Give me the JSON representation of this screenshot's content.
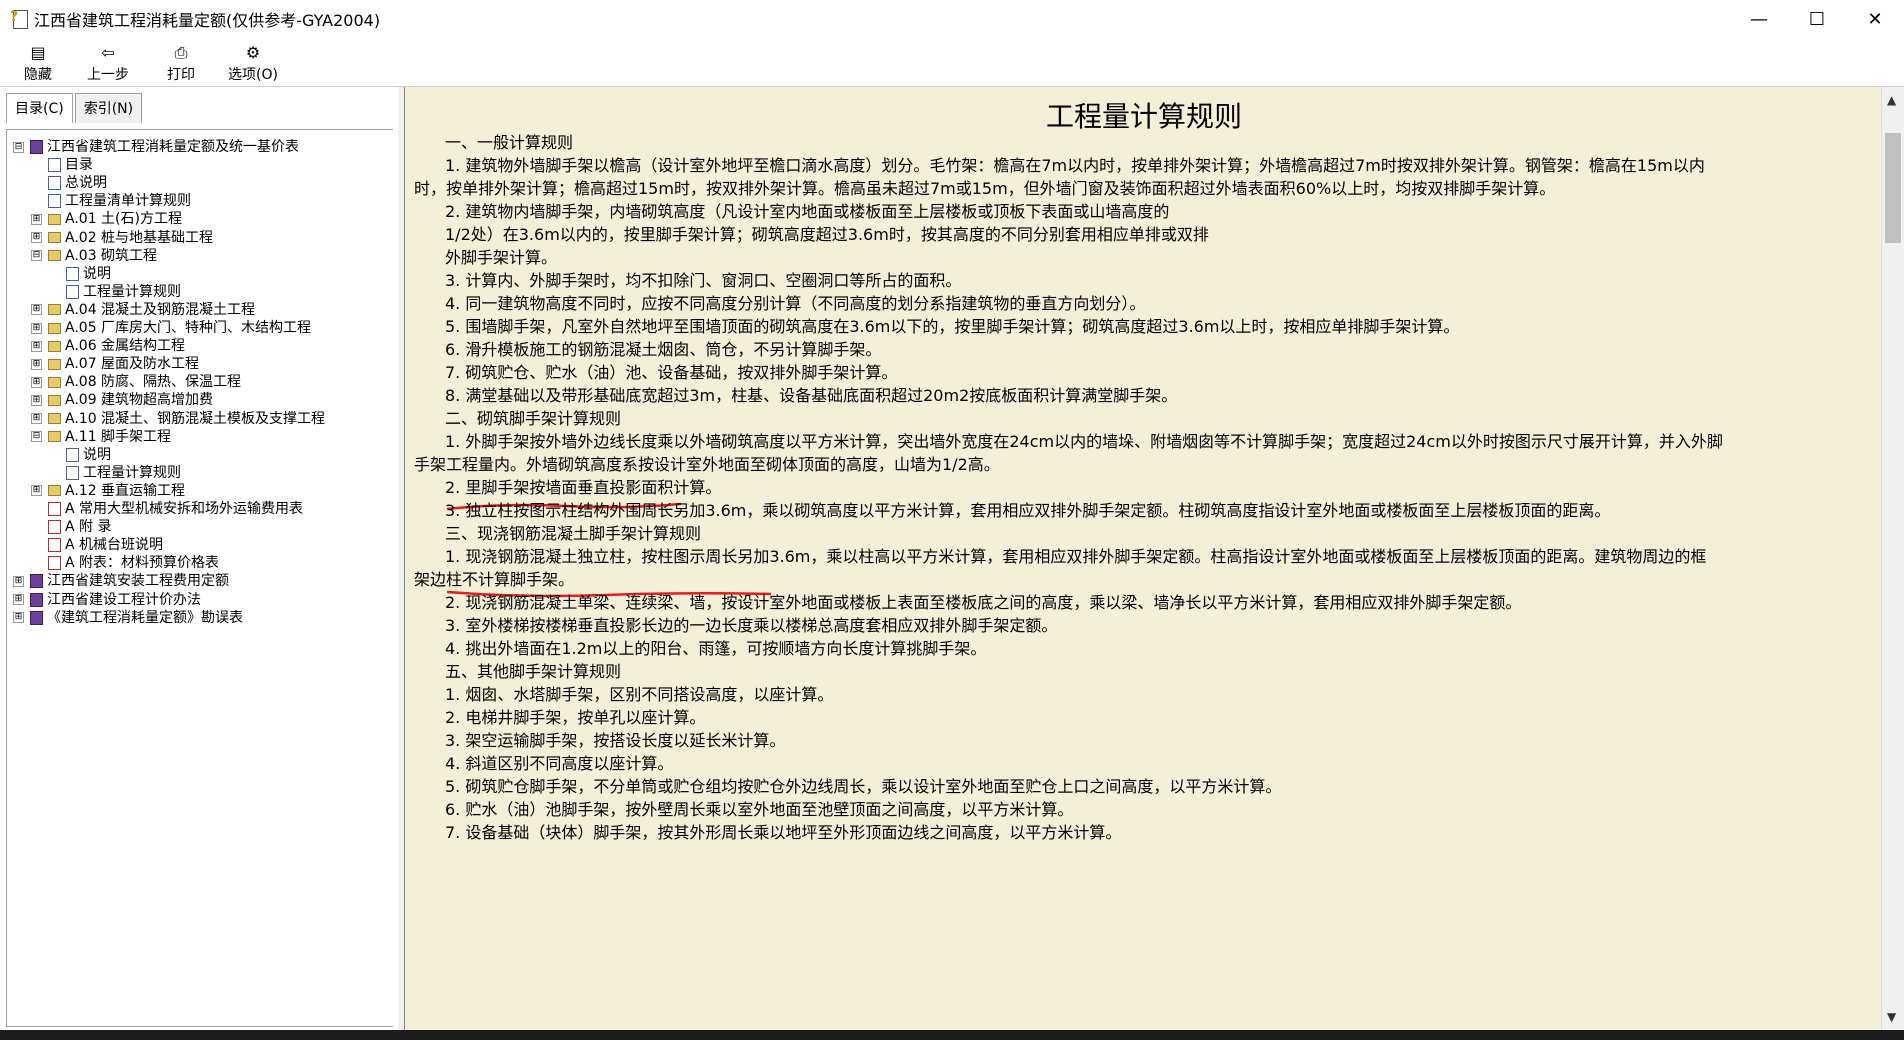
{
  "window": {
    "title": "江西省建筑工程消耗量定额(仅供参考-GYA2004)",
    "minimize": "—",
    "maximize": "☐",
    "close": "✕"
  },
  "toolbar": {
    "hide": "隐藏",
    "back": "上一步",
    "print": "打印",
    "options": "选项(O)",
    "hide_icon": "▤",
    "back_icon": "⇦",
    "print_icon": "⎙",
    "options_icon": "⚙"
  },
  "tabs": {
    "contents": "目录(C)",
    "index": "索引(N)"
  },
  "tree": [
    {
      "label": "江西省建筑工程消耗量定额及统一基价表",
      "expander": "⊟",
      "icon": "book"
    },
    {
      "label": "目录",
      "expander": "",
      "icon": "page"
    },
    {
      "label": "总说明",
      "expander": "",
      "icon": "page"
    },
    {
      "label": "工程量清单计算规则",
      "expander": "",
      "icon": "page"
    },
    {
      "label": "A.01  土(石)方工程",
      "expander": "⊞",
      "icon": "folder"
    },
    {
      "label": "A.02  桩与地基基础工程",
      "expander": "⊞",
      "icon": "folder"
    },
    {
      "label": "A.03  砌筑工程",
      "expander": "⊟",
      "icon": "folder"
    },
    {
      "label": "说明",
      "expander": "",
      "icon": "page"
    },
    {
      "label": "工程量计算规则",
      "expander": "",
      "icon": "page"
    },
    {
      "label": "A.04  混凝土及钢筋混凝土工程",
      "expander": "⊞",
      "icon": "folder"
    },
    {
      "label": "A.05  厂库房大门、特种门、木结构工程",
      "expander": "⊞",
      "icon": "folder"
    },
    {
      "label": "A.06  金属结构工程",
      "expander": "⊞",
      "icon": "folder"
    },
    {
      "label": "A.07  屋面及防水工程",
      "expander": "⊞",
      "icon": "folder"
    },
    {
      "label": "A.08  防腐、隔热、保温工程",
      "expander": "⊞",
      "icon": "folder"
    },
    {
      "label": "A.09  建筑物超高增加费",
      "expander": "⊞",
      "icon": "folder"
    },
    {
      "label": "A.10  混凝土、钢筋混凝土模板及支撑工程",
      "expander": "⊞",
      "icon": "folder"
    },
    {
      "label": "A.11  脚手架工程",
      "expander": "⊟",
      "icon": "folder"
    },
    {
      "label": "说明",
      "expander": "",
      "icon": "page"
    },
    {
      "label": "工程量计算规则",
      "expander": "",
      "icon": "page"
    },
    {
      "label": "A.12  垂直运输工程",
      "expander": "⊞",
      "icon": "folder"
    },
    {
      "label": "A  常用大型机械安拆和场外运输费用表",
      "expander": "",
      "icon": "pdf"
    },
    {
      "label": "A  附  录",
      "expander": "",
      "icon": "pdf"
    },
    {
      "label": "A  机械台班说明",
      "expander": "",
      "icon": "pdf"
    },
    {
      "label": "A  附表：材料预算价格表",
      "expander": "",
      "icon": "pdf"
    },
    {
      "label": "江西省建筑安装工程费用定额",
      "expander": "⊞",
      "icon": "book"
    },
    {
      "label": "江西省建设工程计价办法",
      "expander": "⊞",
      "icon": "book"
    },
    {
      "label": "《建筑工程消耗量定额》勘误表",
      "expander": "⊞",
      "icon": "book"
    }
  ],
  "doc": {
    "title": "工程量计算规则",
    "lines": [
      "一、一般计算规则",
      "1. 建筑物外墙脚手架以檐高（设计室外地坪至檐口滴水高度）划分。毛竹架：檐高在7m以内时，按单排外架计算；外墙檐高超过7m时按双排外架计算。钢管架：檐高在15m以内",
      "时，按单排外架计算；檐高超过15m时，按双排外架计算。檐高虽未超过7m或15m，但外墙门窗及装饰面积超过外墙表面积60%以上时，均按双排脚手架计算。",
      "2. 建筑物内墙脚手架，内墙砌筑高度（凡设计室内地面或楼板面至上层楼板或顶板下表面或山墙高度的",
      "1/2处）在3.6m以内的，按里脚手架计算；砌筑高度超过3.6m时，按其高度的不同分别套用相应单排或双排",
      "外脚手架计算。",
      "3. 计算内、外脚手架时，均不扣除门、窗洞口、空圈洞口等所占的面积。",
      "4. 同一建筑物高度不同时，应按不同高度分别计算（不同高度的划分系指建筑物的垂直方向划分）。",
      "5. 围墙脚手架，凡室外自然地坪至围墙顶面的砌筑高度在3.6m以下的，按里脚手架计算；砌筑高度超过3.6m以上时，按相应单排脚手架计算。",
      "6. 滑升模板施工的钢筋混凝土烟囱、筒仓，不另计算脚手架。",
      "7. 砌筑贮仓、贮水（油）池、设备基础，按双排外脚手架计算。",
      "8. 满堂基础以及带形基础底宽超过3m，柱基、设备基础底面积超过20m2按底板面积计算满堂脚手架。",
      "二、砌筑脚手架计算规则",
      "1. 外脚手架按外墙外边线长度乘以外墙砌筑高度以平方米计算，突出墙外宽度在24cm以内的墙垛、附墙烟囱等不计算脚手架；宽度超过24cm以外时按图示尺寸展开计算，并入外脚",
      "手架工程量内。外墙砌筑高度系按设计室外地面至砌体顶面的高度，山墙为1/2高。",
      "2. 里脚手架按墙面垂直投影面积计算。",
      "3. 独立柱按图示柱结构外围周长另加3.6m，乘以砌筑高度以平方米计算，套用相应双排外脚手架定额。柱砌筑高度指设计室外地面或楼板面至上层楼板顶面的距离。",
      "三、现浇钢筋混凝土脚手架计算规则",
      "1. 现浇钢筋混凝土独立柱，按柱图示周长另加3.6m，乘以柱高以平方米计算，套用相应双排外脚手架定额。柱高指设计室外地面或楼板面至上层楼板顶面的距离。建筑物周边的框",
      "架边柱不计算脚手架。",
      "2. 现浇钢筋混凝土单梁、连续梁、墙，按设计室外地面或楼板上表面至楼板底之间的高度，乘以梁、墙净长以平方米计算，套用相应双排外脚手架定额。",
      "3. 室外楼梯按楼梯垂直投影长边的一边长度乘以楼梯总高度套相应双排外脚手架定额。",
      "4. 挑出外墙面在1.2m以上的阳台、雨篷，可按顺墙方向长度计算挑脚手架。",
      "五、其他脚手架计算规则",
      "1. 烟囱、水塔脚手架，区别不同搭设高度，以座计算。",
      "2. 电梯井脚手架，按单孔以座计算。",
      "3. 架空运输脚手架，按搭设长度以延长米计算。",
      "4. 斜道区别不同高度以座计算。",
      "5. 砌筑贮仓脚手架，不分单筒或贮仓组均按贮仓外边线周长，乘以设计室外地面至贮仓上口之间高度，以平方米计算。",
      "6. 贮水（油）池脚手架，按外壁周长乘以室外地面至池壁顶面之间高度，以平方米计算。",
      "7. 设备基础（块体）脚手架，按其外形周长乘以地坪至外形顶面边线之间高度，以平方米计算。"
    ]
  },
  "colors": {
    "content_bg": "#f4f0d8",
    "annotation": "#e02020"
  }
}
